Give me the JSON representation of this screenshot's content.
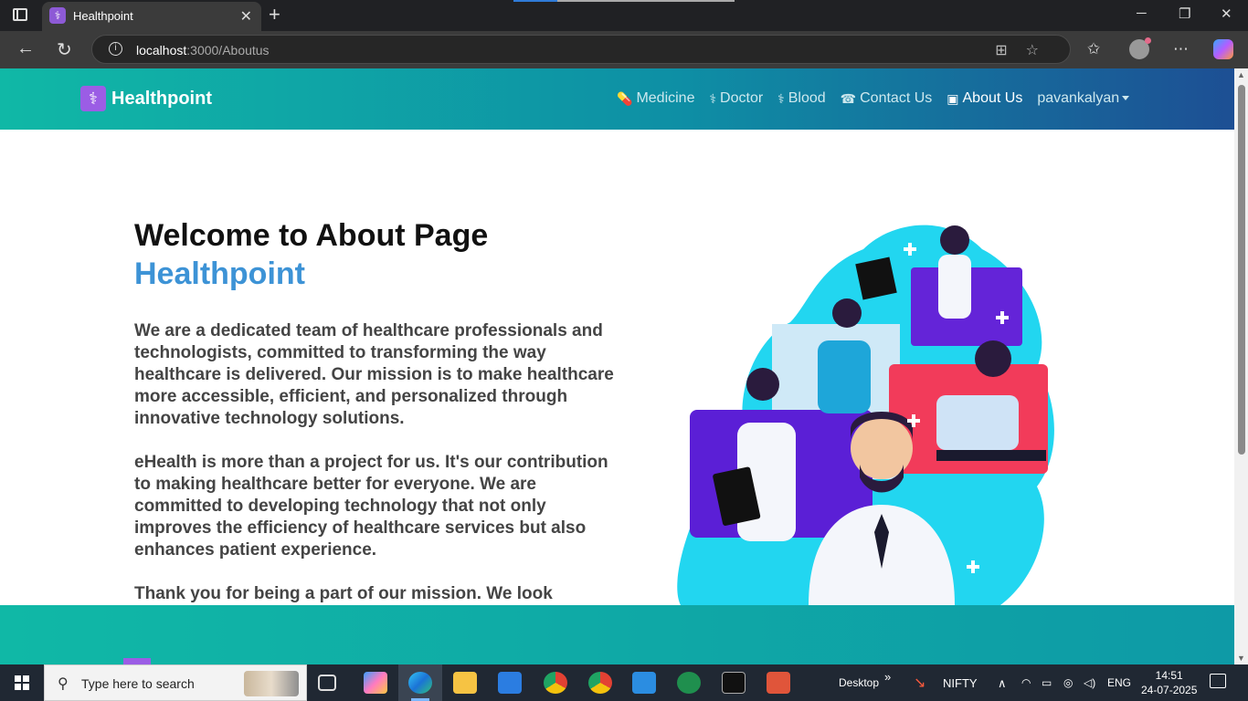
{
  "browser": {
    "tab_title": "Healthpoint",
    "url_host": "localhost",
    "url_path": ":3000/Aboutus"
  },
  "navbar": {
    "brand": "Healthpoint",
    "links": [
      {
        "label": "Medicine",
        "icon": "pills-icon"
      },
      {
        "label": "Doctor",
        "icon": "stethoscope-icon"
      },
      {
        "label": "Blood",
        "icon": "stethoscope-icon"
      },
      {
        "label": "Contact Us",
        "icon": "phone-icon"
      },
      {
        "label": "About Us",
        "icon": "id-card-icon",
        "active": true
      }
    ],
    "user": "pavankalyan"
  },
  "hero": {
    "title": "Welcome to About Page",
    "subtitle": "Healthpoint"
  },
  "content": {
    "p1": "We are a dedicated team of healthcare professionals and technologists, committed to transforming the way healthcare is delivered. Our mission is to make healthcare more accessible, efficient, and personalized through innovative technology solutions.",
    "p2": "eHealth is more than a project for us. It's our contribution to making healthcare better for everyone. We are committed to developing technology that not only improves the efficiency of healthcare services but also enhances patient experience.",
    "p3": "Thank you for being a part of our mission. We look"
  },
  "taskbar": {
    "search_placeholder": "Type here to search",
    "desktop_label": "Desktop",
    "ticker": "NIFTY",
    "lang": "ENG",
    "time": "14:51",
    "date": "24-07-2025"
  },
  "colors": {
    "nav_start": "#10b8a6",
    "nav_end": "#1d4f94",
    "accent": "#3d93d6"
  }
}
